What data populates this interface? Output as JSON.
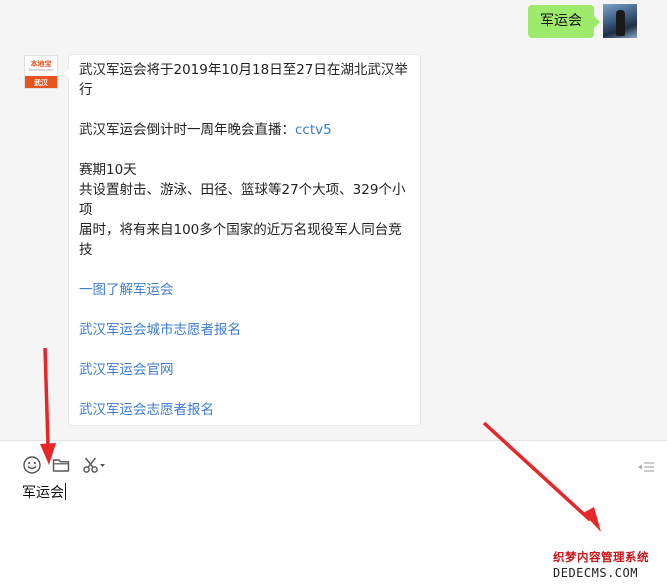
{
  "conversation": {
    "outgoing": {
      "text": "军运会"
    },
    "incoming": {
      "bot_avatar": {
        "brand": "本地宝",
        "sub": "Bendibao.com",
        "city": "武汉"
      },
      "lines": [
        "武汉军运会将于2019年10月18日至27日在湖北武汉举",
        "行",
        "",
        "武汉军运会倒计时一周年晚会直播：",
        "",
        "赛期10天",
        "共设置射击、游泳、田径、篮球等27个大项、329个小",
        "项",
        "届时，将有来自100多个国家的近万名现役军人同台竞",
        "技"
      ],
      "inline_link": "cctv5",
      "links": [
        "一图了解军运会",
        "武汉军运会城市志愿者报名",
        "武汉军运会官网",
        "武汉军运会志愿者报名"
      ]
    }
  },
  "input": {
    "value": "军运会"
  },
  "watermark": {
    "line1": "织梦内容管理系统",
    "line2": "DEDECMS.COM"
  },
  "colors": {
    "outgoing_bubble": "#9eea6a",
    "link": "#3d7ccf",
    "arrow": "#e8262a",
    "brand": "#e8541e"
  }
}
